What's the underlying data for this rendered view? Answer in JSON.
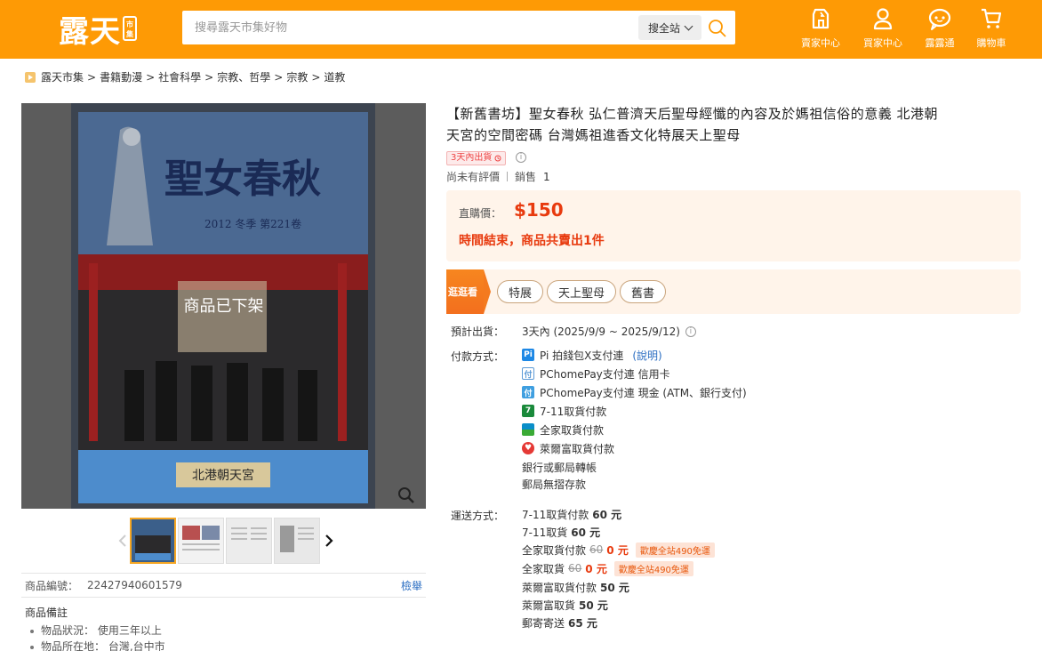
{
  "header": {
    "logo_text": "露天",
    "logo_badge": "市集",
    "search_placeholder": "搜尋露天市集好物",
    "search_scope": "搜全站",
    "nav": [
      {
        "label": "賣家中心",
        "icon": "seller-store-icon"
      },
      {
        "label": "買家中心",
        "icon": "user-icon"
      },
      {
        "label": "露露通",
        "icon": "chat-icon"
      },
      {
        "label": "購物車",
        "icon": "cart-icon"
      }
    ]
  },
  "breadcrumb": [
    "露天市集",
    "書籍動漫",
    "社會科學",
    "宗教、哲學",
    "宗教",
    "道教"
  ],
  "gallery": {
    "overlay": "商品已下架",
    "book_title": "聖女春秋",
    "book_issue": "2012 冬季 第221卷",
    "book_footer": "北港朝天宮"
  },
  "product_id": {
    "label": "商品編號：",
    "value": "22427940601579",
    "report": "檢舉"
  },
  "notes": {
    "title": "商品備註",
    "items": [
      "物品狀況： 使用三年以上",
      "物品所在地： 台灣,台中市"
    ]
  },
  "title_line1": "【新舊書坊】聖女春秋 弘仁普濟天后聖母經懺的內容及於媽祖信俗的意義 北港朝",
  "title_line2": "天宮的空間密碼 台灣媽祖進香文化特展天上聖母",
  "ship_badge": "3天內出貨",
  "rating": {
    "text": "尚未有評價",
    "sales_label": "銷售",
    "sales": "1"
  },
  "price": {
    "label": "直購價：",
    "value": "$150",
    "status": "時間結束，商品共賣出1件"
  },
  "tags": {
    "head": "逛逛看",
    "items": [
      "特展",
      "天上聖母",
      "舊書"
    ]
  },
  "delivery": {
    "label": "預計出貨：",
    "value": "3天內 (2025/9/9 ~ 2025/9/12)"
  },
  "payment": {
    "label": "付款方式：",
    "items": [
      {
        "text": "Pi 拍錢包X支付連",
        "link": "(說明)",
        "icon": "pi-wallet-icon",
        "color": "#1e88e5"
      },
      {
        "text": "PChomePay支付連 信用卡",
        "icon": "pchomepay-card-icon",
        "color": "#5c9ad6"
      },
      {
        "text": "PChomePay支付連 現金 (ATM、銀行支付)",
        "icon": "pchomepay-cash-icon",
        "color": "#3f9fe0"
      },
      {
        "text": "7-11取貨付款",
        "icon": "seven-eleven-icon",
        "color": "#1a8a3b"
      },
      {
        "text": "全家取貨付款",
        "icon": "familymart-icon",
        "color": "#0a8ec9"
      },
      {
        "text": "萊爾富取貨付款",
        "icon": "hilife-icon",
        "color": "#e53935"
      },
      {
        "text": "銀行或郵局轉帳"
      },
      {
        "text": "郵局無摺存款"
      }
    ]
  },
  "shipping": {
    "label": "運送方式：",
    "items": [
      {
        "name": "7-11取貨付款",
        "price": "60 元"
      },
      {
        "name": "7-11取貨",
        "price": "60 元"
      },
      {
        "name": "全家取貨付款",
        "old": "60",
        "price": "0 元",
        "promo": "歡慶全站490免運"
      },
      {
        "name": "全家取貨",
        "old": "60",
        "price": "0 元",
        "promo": "歡慶全站490免運"
      },
      {
        "name": "萊爾富取貨付款",
        "price": "50 元"
      },
      {
        "name": "萊爾富取貨",
        "price": "50 元"
      },
      {
        "name": "郵寄寄送",
        "price": "65 元"
      }
    ]
  },
  "colors": {
    "brand": "#fe9a05",
    "price": "#e83a0e",
    "link": "#2a6dc2"
  }
}
